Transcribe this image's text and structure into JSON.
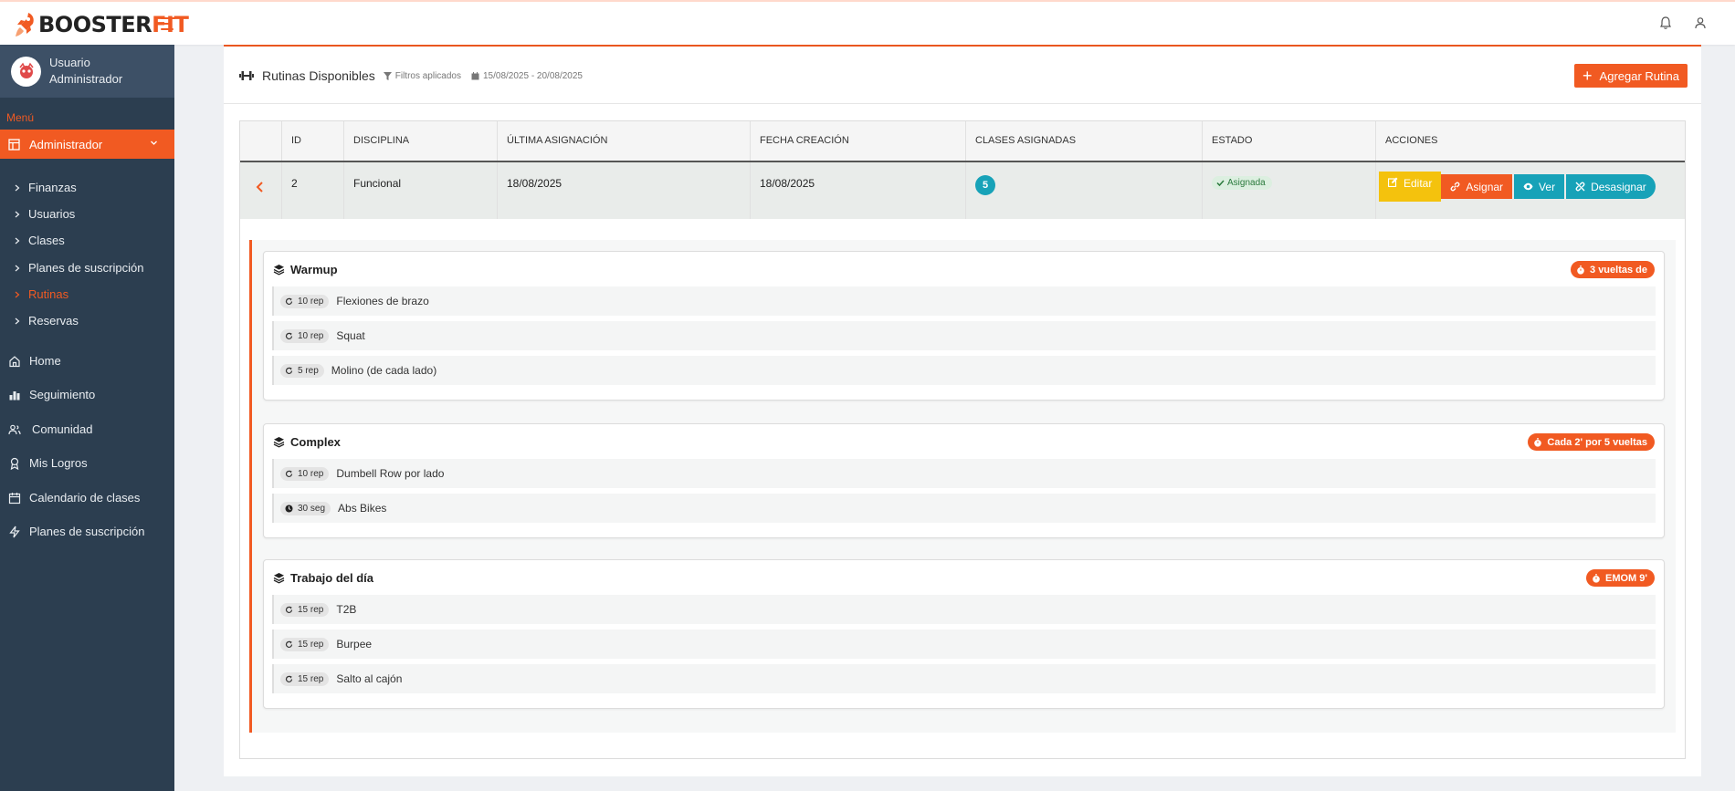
{
  "brand": {
    "part1": "BOOSTER",
    "part2": "FIT",
    "accent": "#f15a22"
  },
  "user": {
    "name": "Usuario Administrador"
  },
  "sidebar": {
    "menu_title": "Menú",
    "admin_label": "Administrador",
    "sub_items": [
      {
        "label": "Finanzas",
        "active": false
      },
      {
        "label": "Usuarios",
        "active": false
      },
      {
        "label": "Clases",
        "active": false
      },
      {
        "label": "Planes de suscripción",
        "active": false
      },
      {
        "label": "Rutinas",
        "active": true
      },
      {
        "label": "Reservas",
        "active": false
      }
    ],
    "main_items": [
      {
        "label": "Home",
        "icon": "home-icon"
      },
      {
        "label": "Seguimiento",
        "icon": "chart-icon"
      },
      {
        "label": "Comunidad",
        "icon": "users-icon"
      },
      {
        "label": "Mis Logros",
        "icon": "award-icon"
      },
      {
        "label": "Calendario de clases",
        "icon": "calendar-icon"
      },
      {
        "label": "Planes de suscripción",
        "icon": "bolt-icon"
      }
    ]
  },
  "header": {
    "title": "Rutinas Disponibles",
    "filters": "Filtros aplicados",
    "date_range": "15/08/2025 - 20/08/2025",
    "add_button": "Agregar Rutina"
  },
  "table": {
    "columns": [
      "ID",
      "DISCIPLINA",
      "ÚLTIMA ASIGNACIÓN",
      "FECHA CREACIÓN",
      "CLASES ASIGNADAS",
      "ESTADO",
      "ACCIONES"
    ],
    "row": {
      "id": "2",
      "discipline": "Funcional",
      "last_assignment": "18/08/2025",
      "created": "18/08/2025",
      "classes": "5",
      "status": "Asignada"
    },
    "actions": {
      "edit": "Editar",
      "assign": "Asignar",
      "view": "Ver",
      "unassign": "Desasignar"
    }
  },
  "blocks": [
    {
      "title": "Warmup",
      "badge": "3 vueltas de",
      "exercises": [
        {
          "qty": "10 rep",
          "name": "Flexiones de brazo",
          "icon": "repeat-icon"
        },
        {
          "qty": "10 rep",
          "name": "Squat",
          "icon": "repeat-icon"
        },
        {
          "qty": "5 rep",
          "name": "Molino (de cada lado)",
          "icon": "repeat-icon"
        }
      ]
    },
    {
      "title": "Complex",
      "badge": "Cada 2' por 5 vueltas",
      "exercises": [
        {
          "qty": "10 rep",
          "name": "Dumbell Row por lado",
          "icon": "repeat-icon"
        },
        {
          "qty": "30 seg",
          "name": "Abs Bikes",
          "icon": "clock-icon"
        }
      ]
    },
    {
      "title": "Trabajo del día",
      "badge": "EMOM 9'",
      "exercises": [
        {
          "qty": "15 rep",
          "name": "T2B",
          "icon": "repeat-icon"
        },
        {
          "qty": "15 rep",
          "name": "Burpee",
          "icon": "repeat-icon"
        },
        {
          "qty": "15 rep",
          "name": "Salto al cajón",
          "icon": "repeat-icon"
        }
      ]
    }
  ]
}
